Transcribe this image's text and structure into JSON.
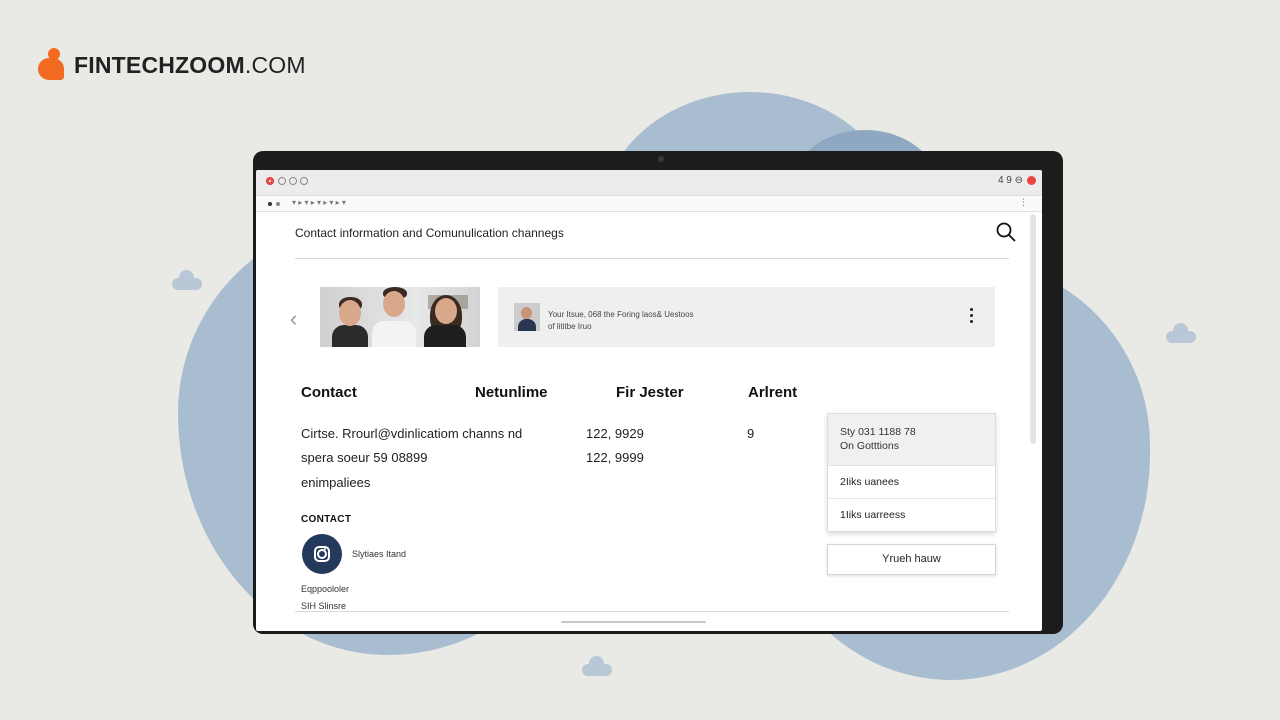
{
  "brand": {
    "name_bold": "FINTECHZOOM",
    "name_rest": ".COM",
    "color": "#f26a21"
  },
  "browser": {
    "right_controls": "4 9 ⊖",
    "address_text": "▾ ▸ ▾ ▸ ▾ ▸ ▾ ▸ ▾",
    "address_menu": "⋮"
  },
  "page": {
    "title": "Contact information and Comunulication channegs",
    "search_icon": "search-icon"
  },
  "carousel": {
    "card_line1": "Your Itsue, 068 the Foring laos& Uestoos",
    "card_line2": "of lititbe Iruo"
  },
  "table": {
    "headers": [
      "Contact",
      "Netunlime",
      "Fir Jester",
      "Arlrent"
    ],
    "rows": [
      {
        "c1": "Cirtse. Rrourl@vdinlicatiom channs nd",
        "c2": "122, 9929",
        "c3": "9"
      },
      {
        "c1": "spera soeur 59 08899",
        "c2": "122, 9999",
        "c3": ""
      },
      {
        "c1": "enimpaliees",
        "c2": "",
        "c3": ""
      }
    ]
  },
  "dropdown": {
    "head_line1": "Sty 031 1188 78",
    "head_line2": "On Gotttions",
    "items": [
      "2Iiks uanees",
      "1Iiks uarreess"
    ]
  },
  "action_button": "Yrueh hauw",
  "contact": {
    "label": "CONTACT",
    "social_name": "Slytiaes Itand",
    "line1": "Eqppoololer",
    "line2": "SIH Slinsre"
  }
}
